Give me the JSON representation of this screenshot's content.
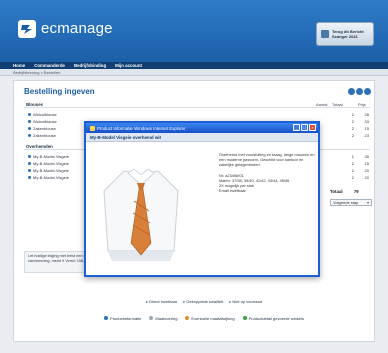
{
  "app": {
    "logo_text": "ecmanage",
    "header_button": "Terug  dit  Bericht Scanger  2041"
  },
  "nav": [
    "Home",
    "Commanderde",
    "Bedrijfsbinding",
    "Mijn account"
  ],
  "breadcrumb": "Bedrijfskrening  »  Bestellen",
  "page": {
    "title": "Bestelling ingeven"
  },
  "table": {
    "columns": {
      "aantal": "Aantal",
      "totaal": "Totaal",
      "prijs": "Prijs"
    },
    "sections": [
      {
        "label": "Blouses",
        "rows": [
          {
            "name": "Wolcolblouse",
            "qty": "2",
            "total": "28"
          },
          {
            "name": "Wolcolblouse",
            "qty": "2",
            "total": "33"
          },
          {
            "name": "Zakenblouse",
            "qty": "2",
            "total": "15"
          },
          {
            "name": "Zakenblouse",
            "qty": "2",
            "total": "23"
          }
        ]
      },
      {
        "label": "Overhemden",
        "rows": [
          {
            "name": "My-B-Model-Visgeie",
            "qty": "1",
            "total": "35"
          },
          {
            "name": "My-B-Model-Visgeie",
            "qty": "2",
            "total": "15"
          },
          {
            "name": "My-B-Model-Visgeie",
            "qty": "2",
            "total": "20"
          },
          {
            "name": "My-B-Model-Visgeie",
            "qty": "2",
            "total": "20"
          }
        ]
      }
    ],
    "total_label": "Totaal",
    "total_value": "79",
    "shipping_select": "Volgende stap"
  },
  "note": "Let hostige leiging met leest een Rene vanvemming, meed 9 Versil: 158, 5.4",
  "popup": {
    "window_title": "Product Informatie   Windows Internet Explorer",
    "heading": "My-B-Model Visgeie overhemd wit",
    "paragraphs": [
      "Overhemd met voorsluiting en kraag, lange mouwen en een moderne pasvorm. Geschikt voor kantoor en zakelijke gelegenheden.",
      "Nr: a23456/01\nMaten: 37/38, 39/40, 41/42, 43/44, 45/46\n2X mogelijk per stuk\nEmail inzetbaar"
    ]
  },
  "actions": [
    "Direct inzetbaar",
    "Gekoppelde kwaliteit",
    "Niet op voorraad"
  ],
  "legend": [
    {
      "label": "Productinformatie",
      "color": "#2a6fb8"
    },
    {
      "label": "Maatvoering",
      "color": "#9aa7b5"
    },
    {
      "label": "Eventuele maatafwijking",
      "color": "#e08a2b"
    },
    {
      "label": "Productdetail gevoerde winkels",
      "color": "#3aa04a"
    }
  ]
}
